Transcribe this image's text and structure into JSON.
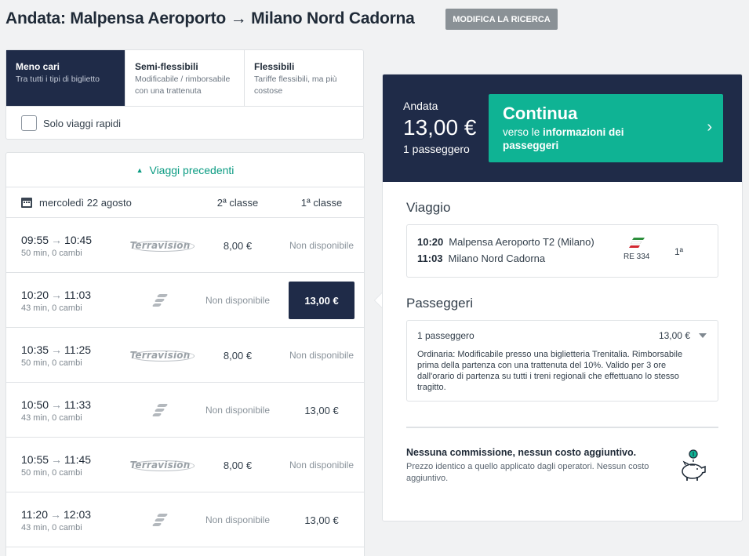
{
  "header": {
    "title": "Andata: Malpensa Aeroporto → Milano Nord Cadorna",
    "modify_label": "MODIFICA LA RICERCA"
  },
  "filters": {
    "tabs": [
      {
        "title": "Meno cari",
        "subtitle": "Tra tutti i tipi di biglietto",
        "active": true
      },
      {
        "title": "Semi-flessibili",
        "subtitle": "Modificabile / rimborsabile con una trattenuta",
        "active": false
      },
      {
        "title": "Flessibili",
        "subtitle": "Tariffe flessibili, ma più costose",
        "active": false
      }
    ],
    "fast_only_label": "Solo viaggi rapidi",
    "fast_only_checked": false
  },
  "list": {
    "prev_label": "Viaggi precedenti",
    "date": "mercoledì 22 agosto",
    "col2_label": "2ª classe",
    "col1_label": "1ª classe",
    "rows": [
      {
        "dep": "09:55",
        "arr": "10:45",
        "duration": "50 min, 0 cambi",
        "operator": "terravision-logo",
        "operator_text": "Terravision",
        "price2": "8,00 €",
        "price1": "Non disponibile",
        "selected": false
      },
      {
        "dep": "10:20",
        "arr": "11:03",
        "duration": "43 min, 0 cambi",
        "operator": "trenitalia-logo",
        "price2": "Non disponibile",
        "price1": "13,00 €",
        "selected": true
      },
      {
        "dep": "10:35",
        "arr": "11:25",
        "duration": "50 min, 0 cambi",
        "operator": "terravision-logo",
        "operator_text": "Terravision",
        "price2": "8,00 €",
        "price1": "Non disponibile",
        "selected": false
      },
      {
        "dep": "10:50",
        "arr": "11:33",
        "duration": "43 min, 0 cambi",
        "operator": "trenitalia-logo",
        "price2": "Non disponibile",
        "price1": "13,00 €",
        "selected": false
      },
      {
        "dep": "10:55",
        "arr": "11:45",
        "duration": "50 min, 0 cambi",
        "operator": "terravision-logo",
        "operator_text": "Terravision",
        "price2": "8,00 €",
        "price1": "Non disponibile",
        "selected": false
      },
      {
        "dep": "11:20",
        "arr": "12:03",
        "duration": "43 min, 0 cambi",
        "operator": "trenitalia-logo",
        "price2": "Non disponibile",
        "price1": "13,00 €",
        "selected": false
      }
    ]
  },
  "summary": {
    "label": "Andata",
    "price": "13,00 €",
    "passengers": "1 passeggero",
    "continue_title": "Continua",
    "continue_sub_prefix": "verso le ",
    "continue_sub_bold": "informazioni dei passeggeri",
    "trip_title": "Viaggio",
    "trip": {
      "dep_time": "10:20",
      "dep_station": "Malpensa Aeroporto T2 (Milano)",
      "arr_time": "11:03",
      "arr_station": "Milano Nord Cadorna",
      "train": "RE 334",
      "class": "1ª"
    },
    "passengers_title": "Passeggeri",
    "passenger_line": "1 passeggero",
    "passenger_price": "13,00 €",
    "passenger_desc": "Ordinaria: Modificabile presso una biglietteria Trenitalia. Rimborsabile prima della partenza con una trattenuta del 10%. Valido per 3 ore dall'orario di partenza su tutti i treni regionali che effettuano lo stesso tragitto.",
    "no_fee_title": "Nessuna commissione, nessun costo aggiuntivo.",
    "no_fee_text": "Prezzo identico a quello applicato dagli operatori. Nessun costo aggiuntivo."
  },
  "colors": {
    "navy": "#1f2b48",
    "teal": "#0fb394",
    "link_teal": "#0a9b82",
    "modify_grey": "#8a9196"
  },
  "icons": [
    "calendar-icon",
    "arrow-right-icon",
    "chevron-right-icon",
    "caret-down-icon",
    "piggy-bank-icon",
    "trenitalia-logo",
    "terravision-logo"
  ]
}
